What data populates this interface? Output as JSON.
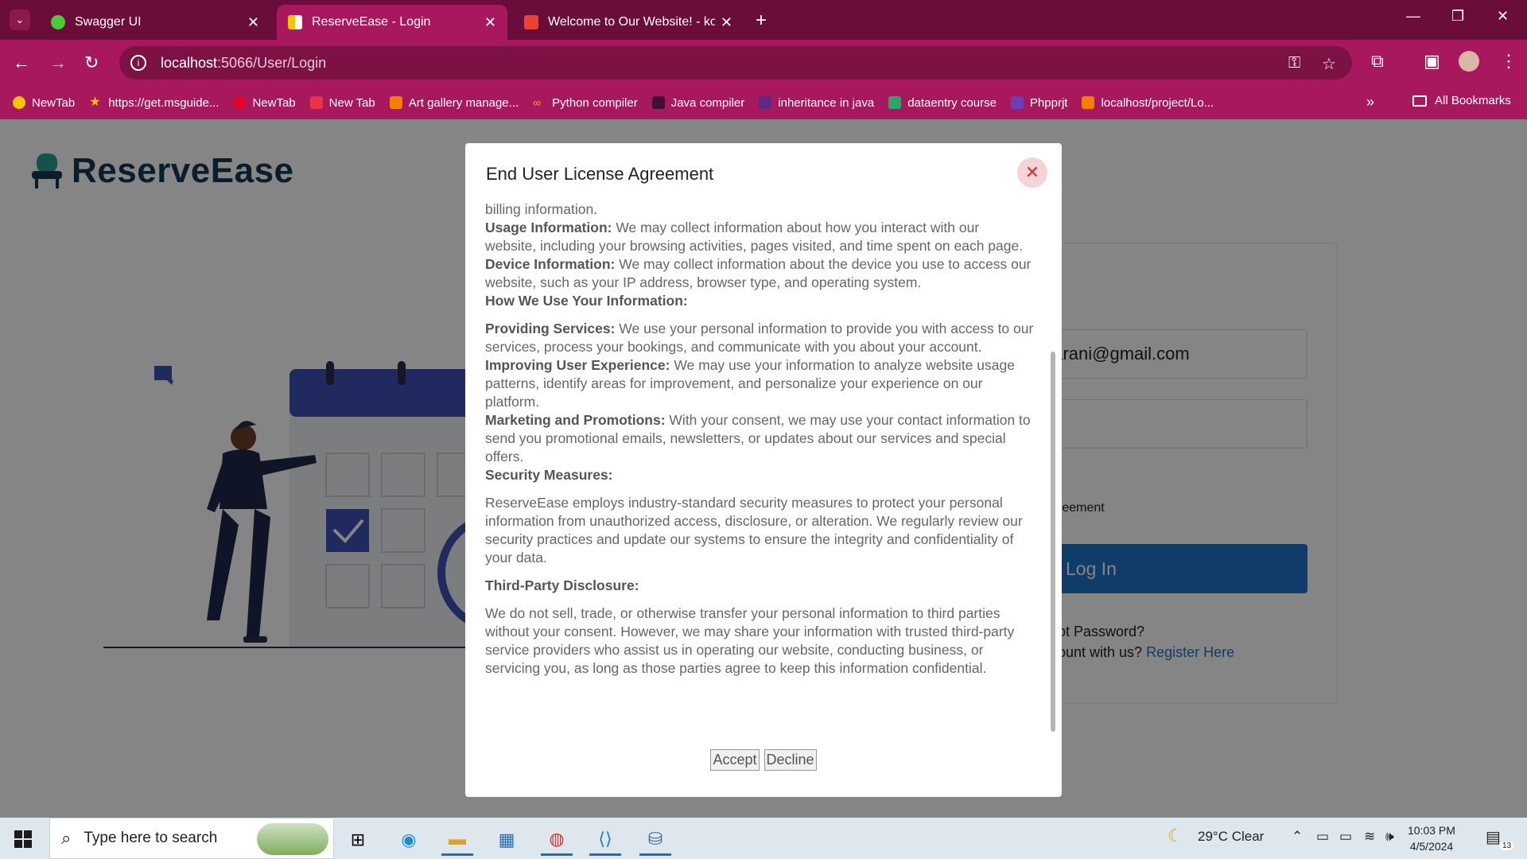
{
  "browser": {
    "tabs": [
      {
        "label": "Swagger UI"
      },
      {
        "label": "ReserveEase - Login"
      },
      {
        "label": "Welcome to Our Website! - kon"
      }
    ],
    "url_host": "localhost",
    "url_path": ":5066/User/Login",
    "bookmarks": [
      {
        "label": "NewTab"
      },
      {
        "label": "https://get.msguide..."
      },
      {
        "label": "NewTab"
      },
      {
        "label": "New Tab"
      },
      {
        "label": "Art gallery manage..."
      },
      {
        "label": "Python compiler"
      },
      {
        "label": "Java compiler"
      },
      {
        "label": "inheritance in java"
      },
      {
        "label": "dataentry course"
      },
      {
        "label": "Phpprjt"
      },
      {
        "label": "localhost/project/Lo..."
      }
    ],
    "all_bookmarks": "All Bookmarks"
  },
  "page": {
    "logo_text": "ReserveEase",
    "email_value": "charani@gmail.com",
    "agreement_fragment": "reement",
    "login_button": "Log In",
    "forgot_fragment": "ot Password?",
    "register_prefix": "ount with us?",
    "register_link": "Register Here"
  },
  "modal": {
    "title": "End User License Agreement",
    "close_icon": "close-icon",
    "lines": {
      "l0": "billing information.",
      "usage_h": "Usage Information:",
      "usage_t": " We may collect information about how you interact with our website, including your browsing activities, pages visited, and time spent on each page.",
      "device_h": "Device Information:",
      "device_t": " We may collect information about the device you use to access our website, such as your IP address, browser type, and operating system.",
      "howuse_h": "How We Use Your Information:",
      "prov_h": "Providing Services:",
      "prov_t": " We use your personal information to provide you with access to our services, process your bookings, and communicate with you about your account.",
      "impr_h": "Improving User Experience:",
      "impr_t": " We may use your information to analyze website usage patterns, identify areas for improvement, and personalize your experience on our platform.",
      "mkt_h": "Marketing and Promotions:",
      "mkt_t": " With your consent, we may use your contact information to send you promotional emails, newsletters, or updates about our services and special offers.",
      "sec_h": "Security Measures:",
      "sec_t": "ReserveEase employs industry-standard security measures to protect your personal information from unauthorized access, disclosure, or alteration. We regularly review our security practices and update our systems to ensure the integrity and confidentiality of your data.",
      "third_h": "Third-Party Disclosure:",
      "third_t": "We do not sell, trade, or otherwise transfer your personal information to third parties without your consent. However, we may share your information with trusted third-party service providers who assist us in operating our website, conducting business, or servicing you, as long as those parties agree to keep this information confidential."
    },
    "accept": "Accept",
    "decline": "Decline"
  },
  "taskbar": {
    "search_placeholder": "Type here to search",
    "weather": "29°C  Clear",
    "time": "10:03 PM",
    "date": "4/5/2024",
    "notif_count": "13"
  },
  "colors": {
    "browser_frame": "#6b0d3a",
    "browser_toolbar": "#a8185c",
    "brand_dark": "#123b52",
    "primary_button": "#1e73c8"
  }
}
